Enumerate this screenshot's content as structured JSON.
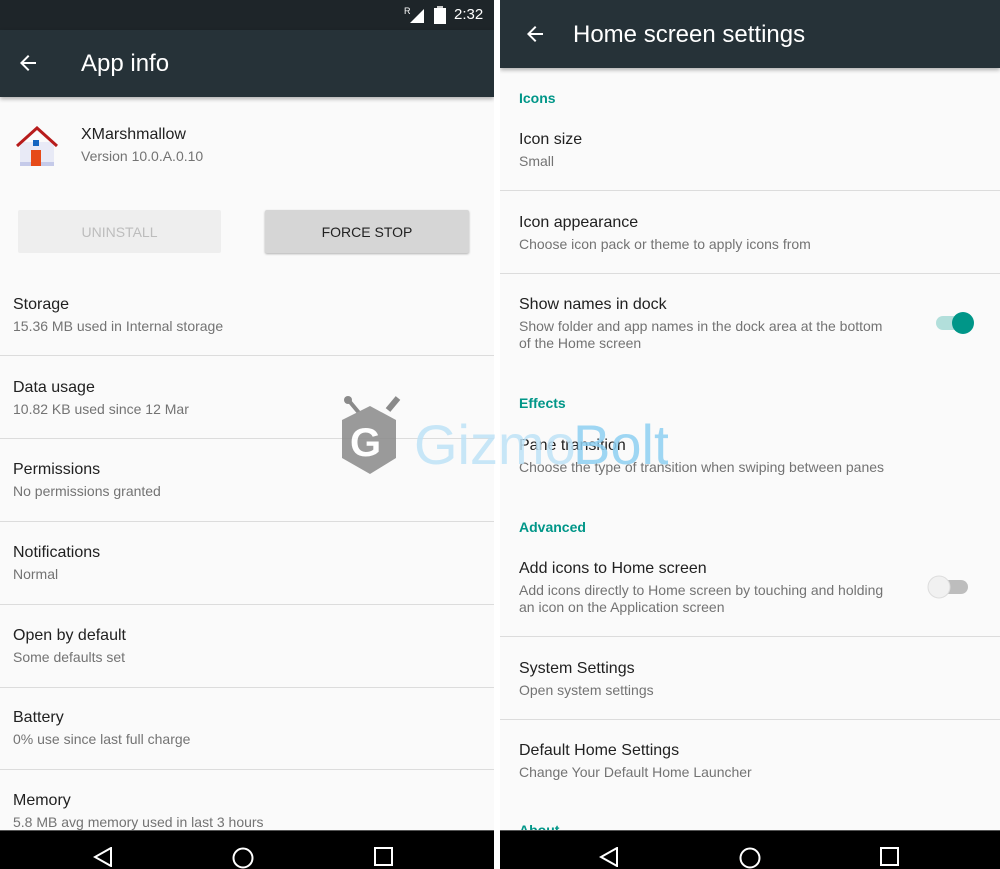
{
  "status_bar": {
    "time": "2:32",
    "icons": [
      "roaming-signal-icon",
      "battery-icon"
    ]
  },
  "app_info": {
    "title": "App info",
    "app_name": "XMarshmallow",
    "version": "Version 10.0.A.0.10",
    "uninstall_label": "UNINSTALL",
    "force_stop_label": "FORCE STOP",
    "rows": [
      {
        "title": "Storage",
        "subtitle": "15.36 MB used in Internal storage"
      },
      {
        "title": "Data usage",
        "subtitle": "10.82 KB used since 12 Mar"
      },
      {
        "title": "Permissions",
        "subtitle": "No permissions granted"
      },
      {
        "title": "Notifications",
        "subtitle": "Normal"
      },
      {
        "title": "Open by default",
        "subtitle": "Some defaults set"
      },
      {
        "title": "Battery",
        "subtitle": "0% use since last full charge"
      },
      {
        "title": "Memory",
        "subtitle": "5.8 MB avg memory used in last 3 hours"
      }
    ]
  },
  "home_settings": {
    "title": "Home screen settings",
    "sections": {
      "icons": "Icons",
      "effects": "Effects",
      "advanced": "Advanced",
      "about": "About"
    },
    "icon_size": {
      "title": "Icon size",
      "subtitle": "Small"
    },
    "icon_appearance": {
      "title": "Icon appearance",
      "subtitle": "Choose icon pack or theme to apply icons from"
    },
    "show_names": {
      "title": "Show names in dock",
      "subtitle1": "Show folder and app names in the dock area at the bottom",
      "subtitle2": "of the Home screen",
      "enabled": true
    },
    "pane_transition": {
      "title": "Pane transition",
      "subtitle": "Choose the type of transition when swiping between panes"
    },
    "add_icons": {
      "title": "Add icons to Home screen",
      "subtitle1": "Add icons directly to Home screen by touching and holding",
      "subtitle2": "an icon on the Application screen",
      "enabled": false
    },
    "system_settings": {
      "title": "System Settings",
      "subtitle": "Open system settings"
    },
    "default_home": {
      "title": "Default Home Settings",
      "subtitle": "Change Your Default Home Launcher"
    }
  },
  "watermark": {
    "text": "GizmoBolt"
  },
  "colors": {
    "toolbar": "#263238",
    "accent": "#009688"
  }
}
